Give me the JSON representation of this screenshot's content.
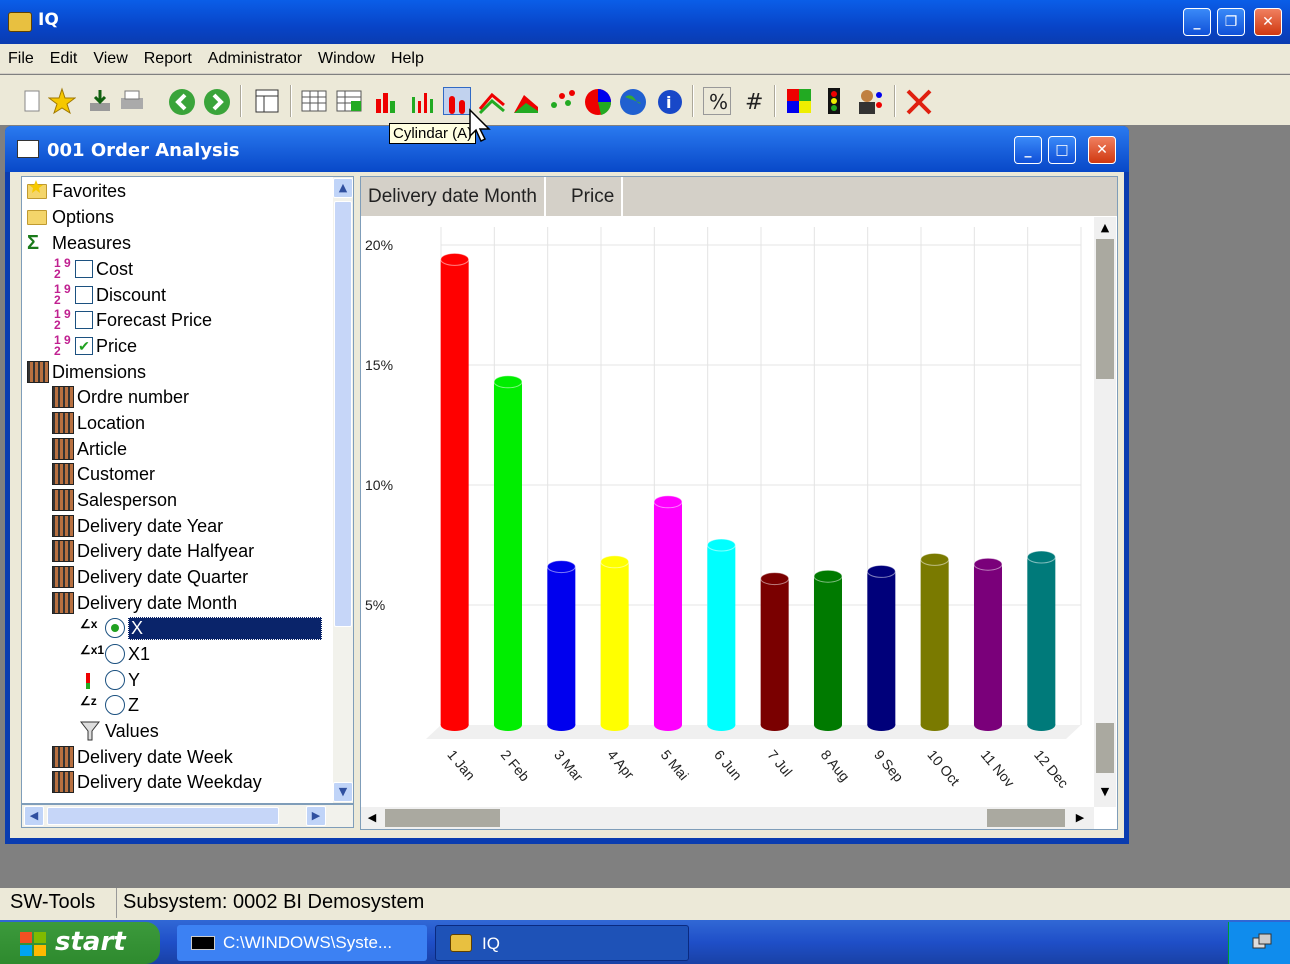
{
  "app": {
    "title": "IQ"
  },
  "menu": [
    "File",
    "Edit",
    "View",
    "Report",
    "Administrator",
    "Window",
    "Help"
  ],
  "toolbar": {
    "tooltip": "Cylindar (A)"
  },
  "child": {
    "title": "001  Order Analysis"
  },
  "tree": {
    "favorites": "Favorites",
    "options": "Options",
    "measures": "Measures",
    "measure_items": [
      {
        "label": "Cost",
        "checked": false
      },
      {
        "label": "Discount",
        "checked": false
      },
      {
        "label": "Forecast Price",
        "checked": false
      },
      {
        "label": "Price",
        "checked": true
      }
    ],
    "dimensions": "Dimensions",
    "dimension_items": [
      "Ordre number",
      "Location",
      "Article",
      "Customer",
      "Salesperson",
      "Delivery date Year",
      "Delivery date Halfyear",
      "Delivery date Quarter",
      "Delivery date Month"
    ],
    "month_axes": [
      {
        "label": "X",
        "selected": true
      },
      {
        "label": "X1",
        "selected": false
      },
      {
        "label": "Y",
        "selected": false
      },
      {
        "label": "Z",
        "selected": false
      }
    ],
    "values": "Values",
    "more_items": [
      "Delivery date Week",
      "Delivery date Weekday"
    ]
  },
  "chart_header": [
    "Delivery date Month",
    "Price"
  ],
  "chart_data": {
    "type": "bar",
    "categories": [
      "1 Jan",
      "2 Feb",
      "3 Mar",
      "4 Apr",
      "5 Mai",
      "6 Jun",
      "7 Jul",
      "8 Aug",
      "9 Sep",
      "10 Oct",
      "11 Nov",
      "12 Dec"
    ],
    "values": [
      19.4,
      14.3,
      6.6,
      6.8,
      9.3,
      7.5,
      6.1,
      6.2,
      6.4,
      6.9,
      6.7,
      7.0
    ],
    "yticks": [
      "20%",
      "15%",
      "10%",
      "5%"
    ],
    "ylim": [
      0,
      20
    ],
    "colors": [
      "#ff0000",
      "#00ee00",
      "#0000ee",
      "#ffff00",
      "#ff00ff",
      "#00ffff",
      "#7a0000",
      "#007a00",
      "#00007a",
      "#7a7a00",
      "#7a007a",
      "#007a7a"
    ],
    "grid": true
  },
  "status": {
    "left": "SW-Tools",
    "right": "Subsystem: 0002 BI Demosystem"
  },
  "taskbar": {
    "start": "start",
    "task1": "C:\\WINDOWS\\Syste...",
    "task2": "IQ"
  }
}
